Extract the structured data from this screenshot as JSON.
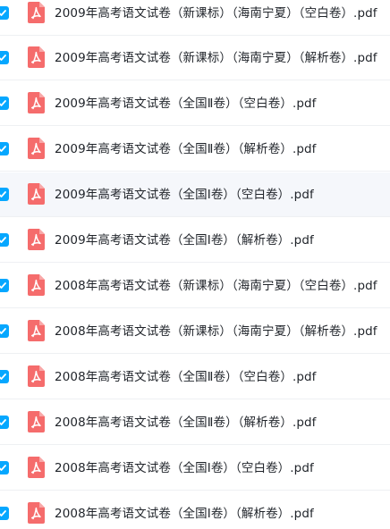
{
  "colors": {
    "checkbox": "#06a7ff",
    "pdf_icon": "#f56c6c",
    "text": "#1f2329",
    "divider": "#eef0f3",
    "hover_row": "#f5f7fb"
  },
  "icons": {
    "checkbox": "check-icon",
    "file": "pdf-file-icon"
  },
  "files": [
    {
      "name": "2009年高考语文试卷（新课标）（海南宁夏）（空白卷）.pdf",
      "selected": true
    },
    {
      "name": "2009年高考语文试卷（新课标）（海南宁夏）（解析卷）.pdf",
      "selected": true
    },
    {
      "name": "2009年高考语文试卷（全国Ⅱ卷）（空白卷）.pdf",
      "selected": true
    },
    {
      "name": "2009年高考语文试卷（全国Ⅱ卷）（解析卷）.pdf",
      "selected": true
    },
    {
      "name": "2009年高考语文试卷（全国Ⅰ卷）（空白卷）.pdf",
      "selected": true
    },
    {
      "name": "2009年高考语文试卷（全国Ⅰ卷）（解析卷）.pdf",
      "selected": true
    },
    {
      "name": "2008年高考语文试卷（新课标）（海南宁夏）（空白卷）.pdf",
      "selected": true
    },
    {
      "name": "2008年高考语文试卷（新课标）（海南宁夏）（解析卷）.pdf",
      "selected": true
    },
    {
      "name": "2008年高考语文试卷（全国Ⅱ卷）（空白卷）.pdf",
      "selected": true
    },
    {
      "name": "2008年高考语文试卷（全国Ⅱ卷）（解析卷）.pdf",
      "selected": true
    },
    {
      "name": "2008年高考语文试卷（全国Ⅰ卷）（空白卷）.pdf",
      "selected": true
    },
    {
      "name": "2008年高考语文试卷（全国Ⅰ卷）（解析卷）.pdf",
      "selected": true
    }
  ]
}
